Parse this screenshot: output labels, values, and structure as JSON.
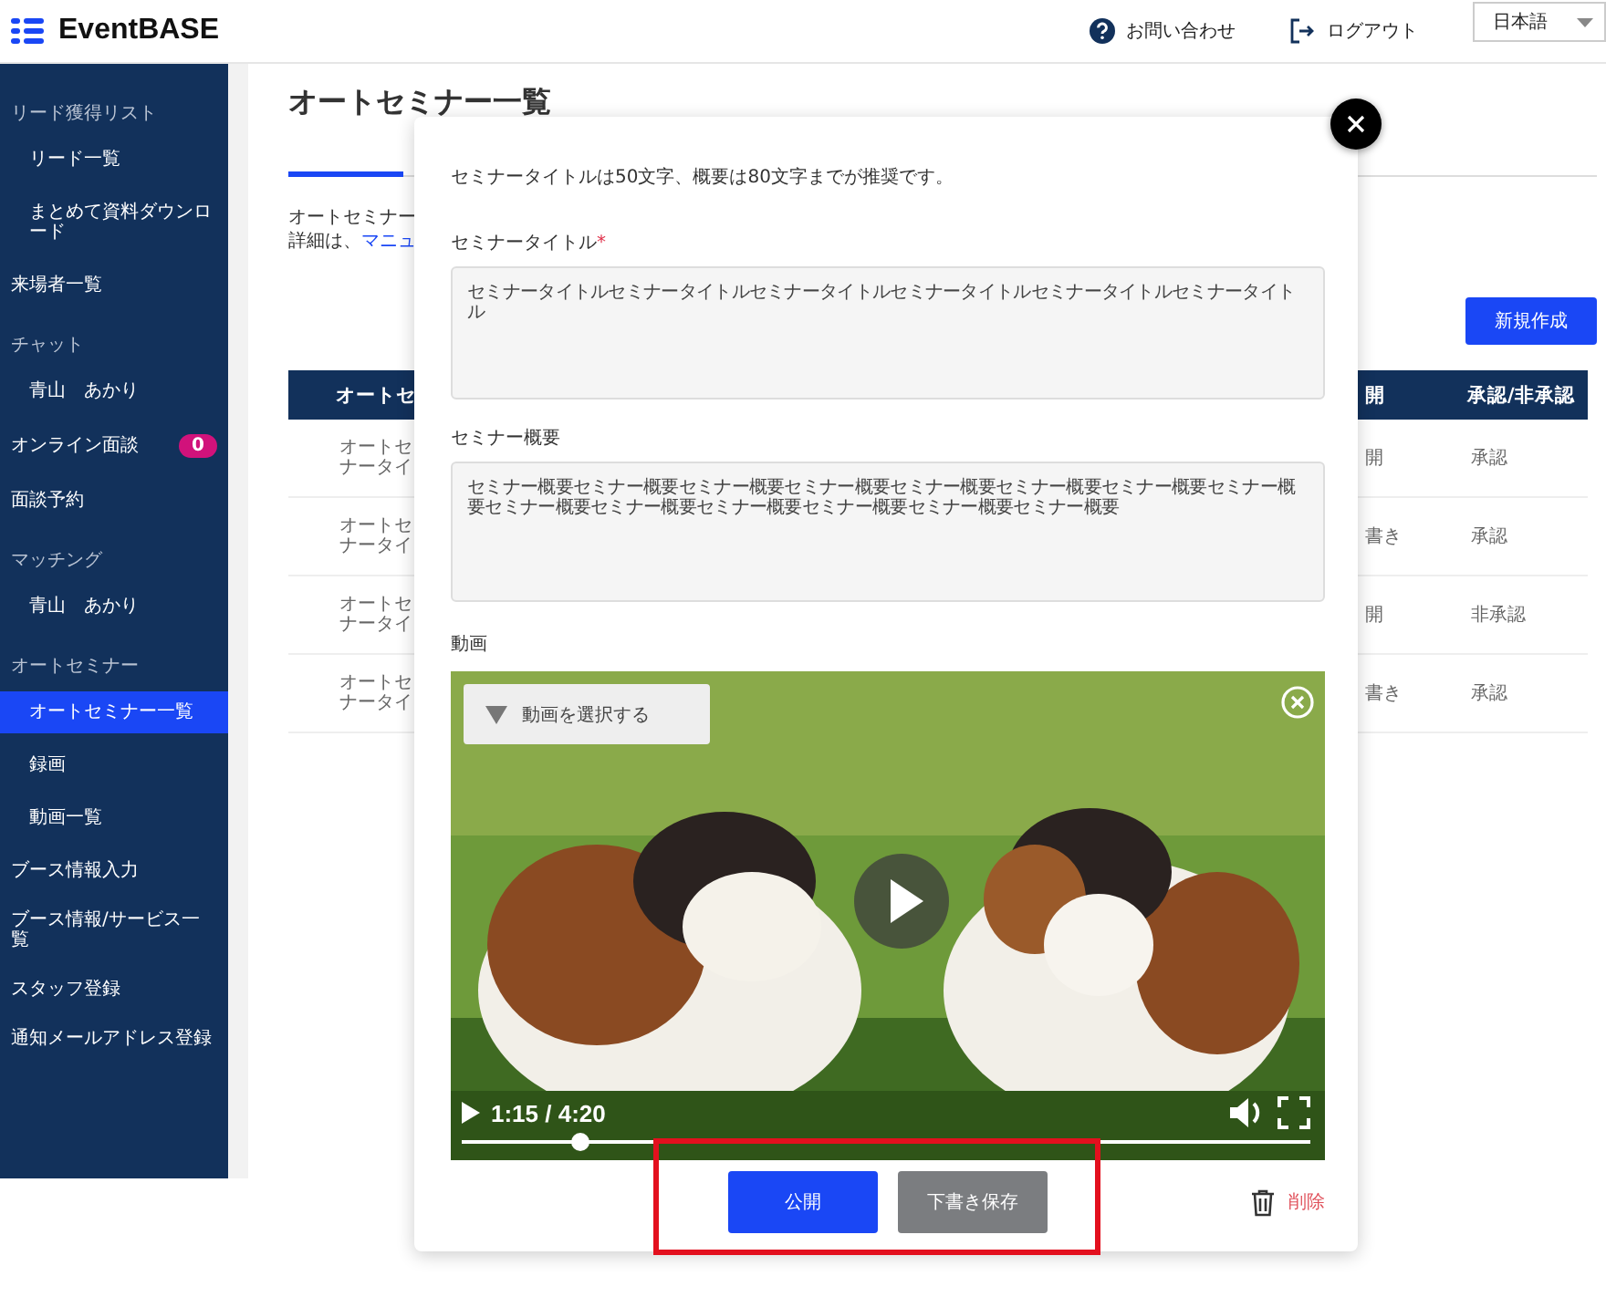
{
  "header": {
    "logo": "EventBASE",
    "contact": "お問い合わせ",
    "logout": "ログアウト",
    "language": "日本語"
  },
  "sidebar": {
    "items": [
      {
        "kind": "section",
        "label": "リード獲得リスト",
        "selected": false
      },
      {
        "kind": "sub",
        "label": "リード一覧",
        "selected": false
      },
      {
        "kind": "sub",
        "label": "まとめて資料ダウンロード",
        "selected": false
      },
      {
        "kind": "top",
        "label": "来場者一覧",
        "selected": false
      },
      {
        "kind": "section",
        "label": "チャット",
        "selected": false
      },
      {
        "kind": "sub",
        "label": "青山　あかり",
        "selected": false
      },
      {
        "kind": "top",
        "label": "オンライン面談",
        "badge": "0",
        "selected": false
      },
      {
        "kind": "top",
        "label": "面談予約",
        "selected": false
      },
      {
        "kind": "section",
        "label": "マッチング",
        "selected": false
      },
      {
        "kind": "sub",
        "label": "青山　あかり",
        "selected": false
      },
      {
        "kind": "section",
        "label": "オートセミナー",
        "selected": false
      },
      {
        "kind": "sub",
        "label": "オートセミナー一覧",
        "selected": true
      },
      {
        "kind": "sub",
        "label": "録画",
        "selected": false
      },
      {
        "kind": "sub",
        "label": "動画一覧",
        "selected": false
      },
      {
        "kind": "small",
        "label": "ブース情報入力",
        "selected": false
      },
      {
        "kind": "small",
        "label": "ブース情報/サービス一覧",
        "selected": false
      },
      {
        "kind": "small",
        "label": "スタッフ登録",
        "selected": false
      },
      {
        "kind": "small",
        "label": "通知メールアドレス登録",
        "selected": false
      }
    ]
  },
  "main": {
    "title": "オートセミナー一覧",
    "description": "オートセミナー",
    "details": "詳細は、",
    "details_link": "マニュ",
    "new_button": "新規作成",
    "table": {
      "columns": [
        "オートセ",
        "開",
        "承認/非承認"
      ],
      "rows": [
        {
          "title": "オートセナータイ",
          "status": "開",
          "approval": "承認"
        },
        {
          "title": "オートセナータイ",
          "status": "書き",
          "approval": "承認"
        },
        {
          "title": "オートセナータイ",
          "status": "開",
          "approval": "非承認"
        },
        {
          "title": "オートセナータイ",
          "status": "書き",
          "approval": "承認"
        }
      ]
    }
  },
  "modal": {
    "hint": "セミナータイトルは50文字、概要は80文字までが推奨です。",
    "fields": [
      {
        "label": "セミナータイトル",
        "required_mark": "*",
        "value": "セミナータイトルセミナータイトルセミナータイトルセミナータイトルセミナータイトルセミナータイトル"
      },
      {
        "label": "セミナー概要",
        "value": "セミナー概要セミナー概要セミナー概要セミナー概要セミナー概要セミナー概要セミナー概要セミナー概要セミナー概要セミナー概要セミナー概要セミナー概要セミナー概要セミナー概要"
      }
    ],
    "video": {
      "label": "動画",
      "select": "動画を選択する",
      "time": "1:15 / 4:20",
      "level": 0.14
    },
    "buttons": {
      "publish": "公開",
      "draft": "下書き保存",
      "delete": "削除"
    }
  }
}
